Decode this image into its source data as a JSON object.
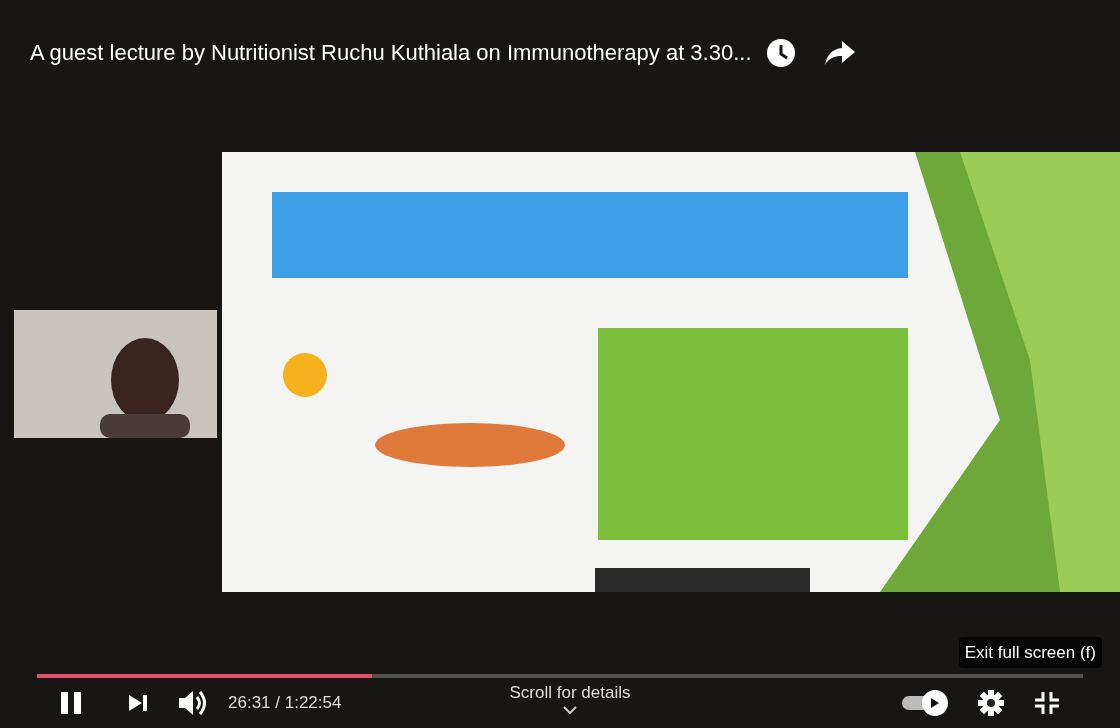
{
  "title": "A guest lecture by Nutritionist Ruchu Kuthiala on Immunotherapy at 3.30...",
  "progress": {
    "level": 0.32
  },
  "controls": {
    "playing": true,
    "time": "26:31 / 1:22:54",
    "scroll_hint": "Scroll for details",
    "autoplay": {
      "on": true
    }
  },
  "tooltip": "Exit full screen (f)"
}
